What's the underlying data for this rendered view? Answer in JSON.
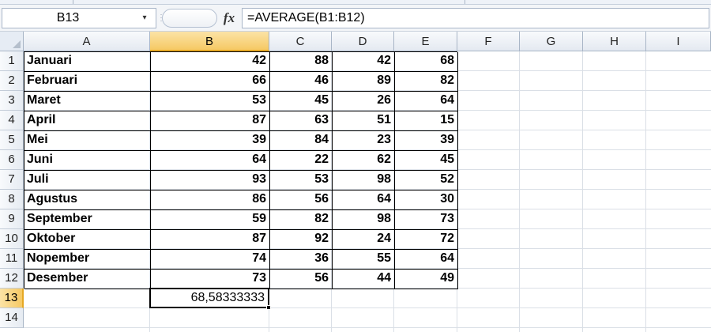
{
  "formula_bar": {
    "name_box": "B13",
    "name_box_arrow": "▾",
    "fx_label": "fx",
    "formula": "=AVERAGE(B1:B12)"
  },
  "grid": {
    "columns": [
      "A",
      "B",
      "C",
      "D",
      "E",
      "F",
      "G",
      "H",
      "I"
    ],
    "rows": [
      "1",
      "2",
      "3",
      "4",
      "5",
      "6",
      "7",
      "8",
      "9",
      "10",
      "11",
      "12",
      "13",
      "14"
    ],
    "selected_column": "B",
    "selected_row": "13",
    "data": [
      {
        "month": "Januari",
        "b": "42",
        "c": "88",
        "d": "42",
        "e": "68"
      },
      {
        "month": "Februari",
        "b": "66",
        "c": "46",
        "d": "89",
        "e": "82"
      },
      {
        "month": "Maret",
        "b": "53",
        "c": "45",
        "d": "26",
        "e": "64"
      },
      {
        "month": "April",
        "b": "87",
        "c": "63",
        "d": "51",
        "e": "15"
      },
      {
        "month": "Mei",
        "b": "39",
        "c": "84",
        "d": "23",
        "e": "39"
      },
      {
        "month": "Juni",
        "b": "64",
        "c": "22",
        "d": "62",
        "e": "45"
      },
      {
        "month": "Juli",
        "b": "93",
        "c": "53",
        "d": "98",
        "e": "52"
      },
      {
        "month": "Agustus",
        "b": "86",
        "c": "56",
        "d": "64",
        "e": "30"
      },
      {
        "month": "September",
        "b": "59",
        "c": "82",
        "d": "98",
        "e": "73"
      },
      {
        "month": "Oktober",
        "b": "87",
        "c": "92",
        "d": "24",
        "e": "72"
      },
      {
        "month": "Nopember",
        "b": "74",
        "c": "36",
        "d": "55",
        "e": "64"
      },
      {
        "month": "Desember",
        "b": "73",
        "c": "56",
        "d": "44",
        "e": "49"
      }
    ],
    "result": "68,58333333"
  },
  "colors": {
    "selected_header": "#f6c964",
    "selected_accent": "#e5a823",
    "header_bg": "#e4e9f1",
    "gridline": "#dadfe6"
  }
}
